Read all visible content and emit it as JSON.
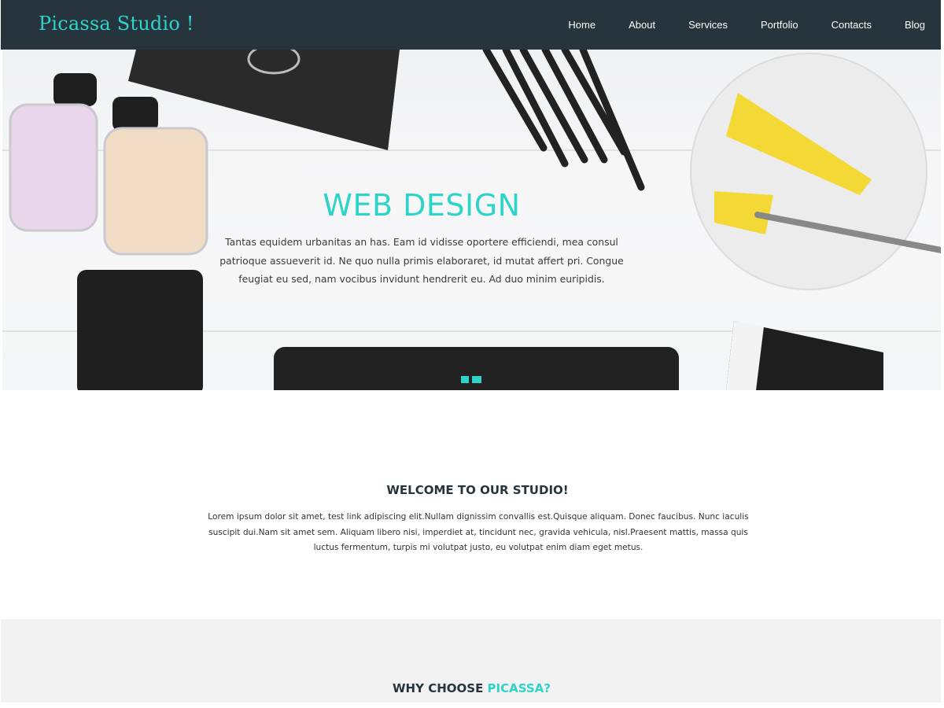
{
  "brand": {
    "name": "Picassa Studio !"
  },
  "nav": {
    "items": [
      {
        "label": "Home"
      },
      {
        "label": "About"
      },
      {
        "label": "Services"
      },
      {
        "label": "Portfolio"
      },
      {
        "label": "Contacts"
      },
      {
        "label": "Blog"
      }
    ]
  },
  "hero": {
    "title": "WEB DESIGN",
    "text": "Tantas equidem urbanitas an has. Eam id vidisse oportere efficiendi, mea consul patrioque assueverit id. Ne quo nulla primis elaboraret, id mutat affert pri. Congue feugiat eu sed, nam vocibus invidunt hendrerit eu. Ad duo minim euripidis."
  },
  "welcome": {
    "title": "WELCOME TO OUR STUDIO!",
    "text": "Lorem ipsum dolor sit amet, test link adipiscing elit.Nullam dignissim convallis est.Quisque aliquam. Donec faucibus. Nunc iaculis suscipit dui.Nam sit amet sem. Aliquam libero nisi, imperdiet at, tincidunt nec, gravida vehicula, nisl.Praesent mattis, massa quis luctus fermentum, turpis mi volutpat justo, eu volutpat enim diam eget metus."
  },
  "why": {
    "title_prefix": "WHY CHOOSE ",
    "title_accent": "PICASSA?"
  },
  "colors": {
    "accent": "#2ed3c9",
    "navbar_bg": "#26343d",
    "section_bg": "#f2f2f2"
  }
}
